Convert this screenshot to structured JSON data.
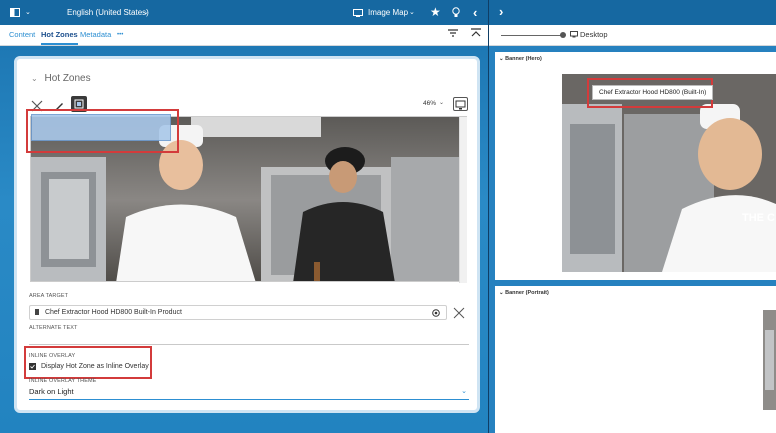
{
  "topbar": {
    "language": "English (United States)",
    "view_mode": "Image Map"
  },
  "tabs": [
    {
      "label": "Content"
    },
    {
      "label": "Hot Zones"
    },
    {
      "label": "Metadata"
    },
    {
      "label": "•••"
    }
  ],
  "hotzones": {
    "section_title": "Hot Zones",
    "zoom": "46%",
    "area_target_label": "AREA TARGET",
    "area_target_value": "Chef Extractor Hood HD800 Built-In Product",
    "alternate_text_label": "ALTERNATE TEXT",
    "alternate_text_value": "",
    "inline_overlay_label": "INLINE OVERLAY",
    "inline_overlay_checkbox_label": "Display Hot Zone as Inline Overlay",
    "inline_overlay_checked": true,
    "theme_label": "INLINE OVERLAY THEME",
    "theme_value": "Dark on Light"
  },
  "preview": {
    "device_label": "Desktop",
    "hero_title": "Banner (Hero)",
    "portrait_title": "Banner (Portrait)",
    "tooltip": "Chef Extractor Hood HD800 (Built-In)",
    "hero_overlay_text": "THE C"
  },
  "colors": {
    "brand": "#1668a1",
    "accent": "#2d8fd2",
    "highlight_red": "#d33b3b",
    "hotzone_fill": "#a9c8ea"
  }
}
